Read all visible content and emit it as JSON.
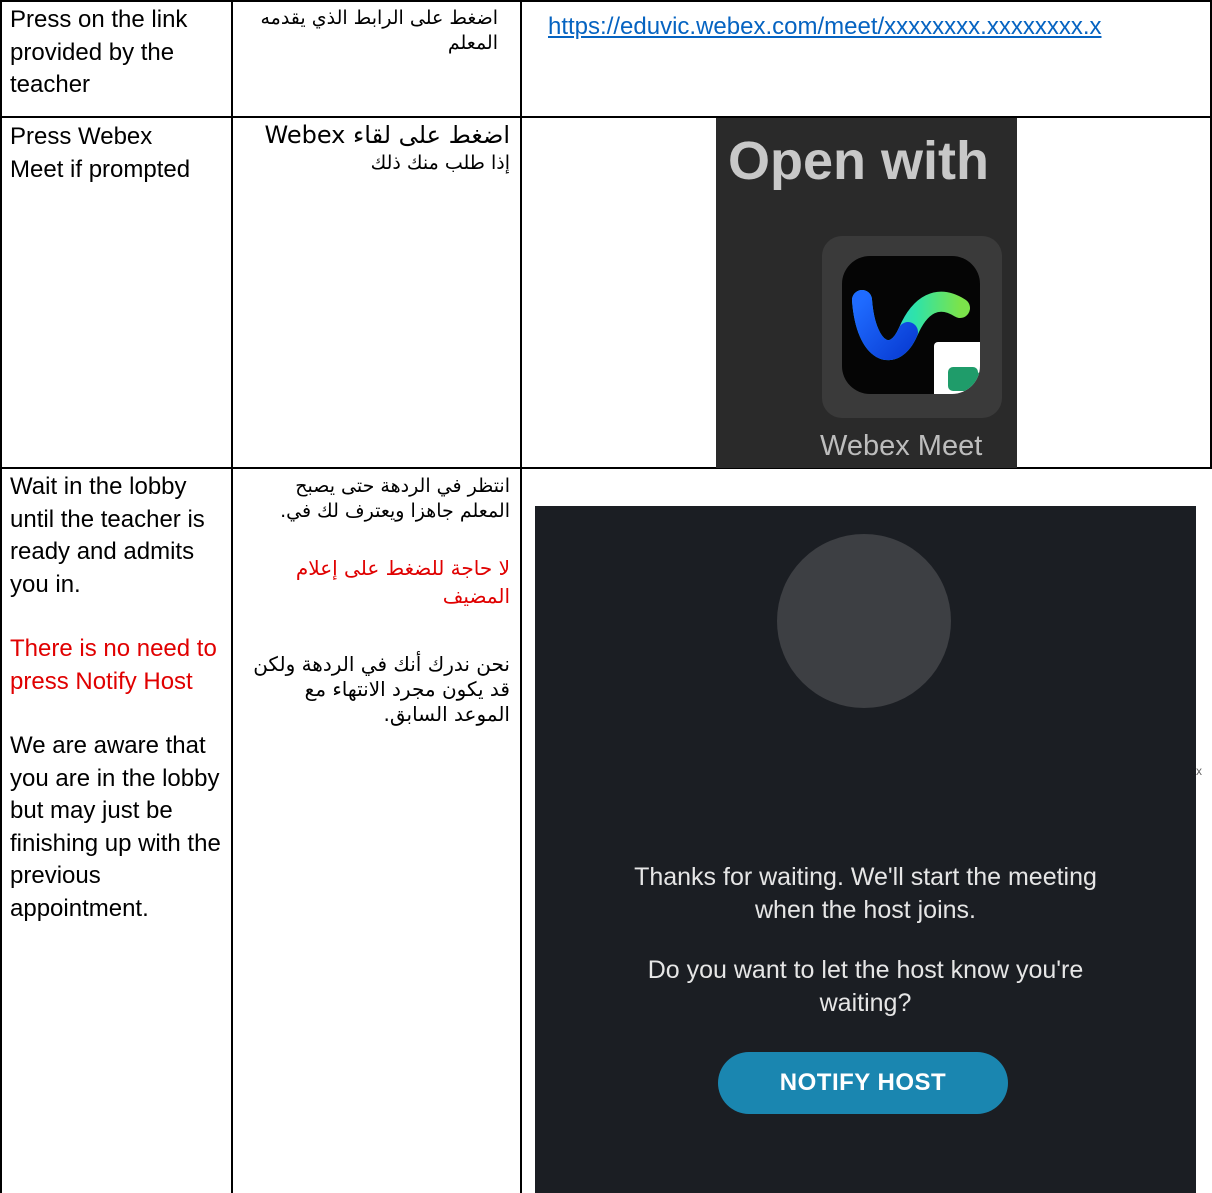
{
  "rows": [
    {
      "english": "Press on the link provided by the teacher",
      "arabic": "اضغط على الرابط الذي يقدمه المعلم",
      "link_text": "https://eduvic.webex.com/meet/xxxxxxxx.xxxxxxxx.x"
    },
    {
      "english": "Press Webex Meet if prompted",
      "arabic_line1": "اضغط على لقاء Webex",
      "arabic_line2": "إذا طلب منك ذلك",
      "open_with": {
        "title": "Open with",
        "app_label": "Webex Meet",
        "app_icon": "webex-meet-app-icon"
      }
    },
    {
      "english_intro": "Wait in the lobby until the teacher is ready and admits you in.",
      "english_note": "There is no need to press Notify Host",
      "english_aware": "We are aware that you are in the lobby but may just be finishing up with the previous appointment.",
      "arabic_intro": "انتظر في الردهة حتى يصبح المعلم جاهزا ويعترف لك في.",
      "arabic_note": "لا حاجة للضغط على إعلام المضيف",
      "arabic_aware": "نحن ندرك أنك في الردهة ولكن قد يكون مجرد الانتهاء مع الموعد السابق.",
      "lobby": {
        "message1": "Thanks for waiting. We'll start the meeting when the host joins.",
        "message2": "Do you want to let the host know you're waiting?",
        "button": "NOTIFY HOST"
      }
    }
  ],
  "colors": {
    "note_red": "#e00000",
    "link_blue": "#0563c1",
    "lobby_bg": "#1b1e23",
    "button_blue": "#1a86b0"
  },
  "stray_mark": "x"
}
